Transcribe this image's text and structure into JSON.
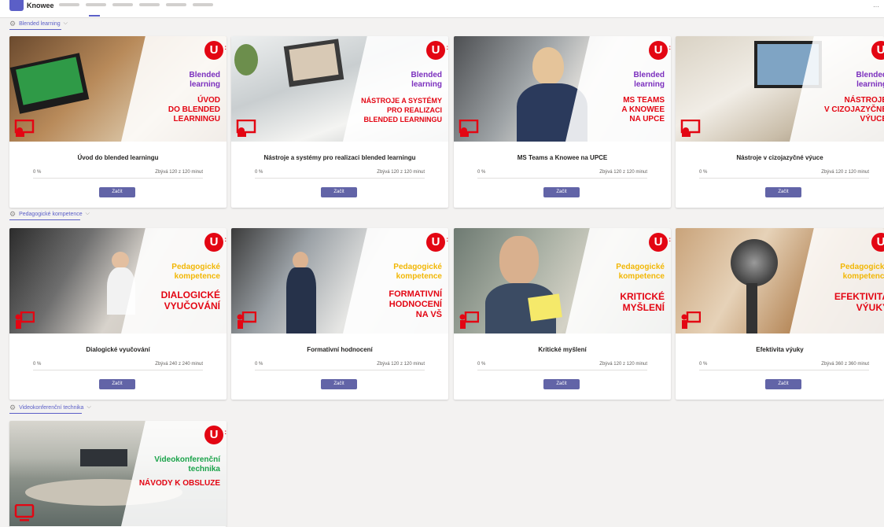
{
  "app": {
    "title": "Knowee"
  },
  "sections": [
    {
      "name": "Blended learning",
      "courses": [
        {
          "title": "Úvod do blended learningu",
          "cat": "Blended\nlearning",
          "banner": "ÚVOD\nDO BLENDED\nLEARNINGU",
          "progress": "0 %",
          "remaining": "Zbývá 120 z 120 minut",
          "button": "Začít"
        },
        {
          "title": "Nástroje a systémy pro realizaci blended learningu",
          "cat": "Blended\nlearning",
          "banner": "NÁSTROJE A SYSTÉMY\nPRO REALIZACI\nBLENDED LEARNINGU",
          "progress": "0 %",
          "remaining": "Zbývá 120 z 120 minut",
          "button": "Začít"
        },
        {
          "title": "MS Teams a Knowee na UPCE",
          "cat": "Blended\nlearning",
          "banner": "MS TEAMS\nA KNOWEE\nNA UPCE",
          "progress": "0 %",
          "remaining": "Zbývá 120 z 120 minut",
          "button": "Začít"
        },
        {
          "title": "Nástroje v cizojazyčné výuce",
          "cat": "Blended\nlearning",
          "banner": "NÁSTROJE\nV CIZOJAZYČNÉ\nVÝUCE",
          "progress": "0 %",
          "remaining": "Zbývá 120 z 120 minut",
          "button": "Začít"
        }
      ]
    },
    {
      "name": "Pedagogické kompetence",
      "courses": [
        {
          "title": "Dialogické vyučování",
          "cat": "Pedagogické\nkompetence",
          "banner": "DIALOGICKÉ\nVYUČOVÁNÍ",
          "progress": "0 %",
          "remaining": "Zbývá 240 z 240 minut",
          "button": "Začít"
        },
        {
          "title": "Formativní hodnocení",
          "cat": "Pedagogické\nkompetence",
          "banner": "FORMATIVNÍ\nHODNOCENÍ\nNA VŠ",
          "progress": "0 %",
          "remaining": "Zbývá 120 z 120 minut",
          "button": "Začít"
        },
        {
          "title": "Kritické myšlení",
          "cat": "Pedagogické\nkompetence",
          "banner": "KRITICKÉ\nMYŠLENÍ",
          "progress": "0 %",
          "remaining": "Zbývá 120 z 120 minut",
          "button": "Začít"
        },
        {
          "title": "Efektivita výuky",
          "cat": "Pedagogické\nkompetence",
          "banner": "EFEKTIVITA\nVÝUKY",
          "progress": "0 %",
          "remaining": "Zbývá 360 z 360 minut",
          "button": "Začít"
        }
      ]
    },
    {
      "name": "Videokonferenční technika",
      "courses": [
        {
          "cat": "Videokonferenční\ntechnika",
          "banner": "NÁVODY K OBSLUZE"
        }
      ]
    }
  ],
  "colors": {
    "blended_cat": "#7b2fbe",
    "pedagog_cat": "#f2b705",
    "video_cat": "#1aa34a",
    "accent": "#5b5fc7",
    "brand_red": "#e30613"
  }
}
